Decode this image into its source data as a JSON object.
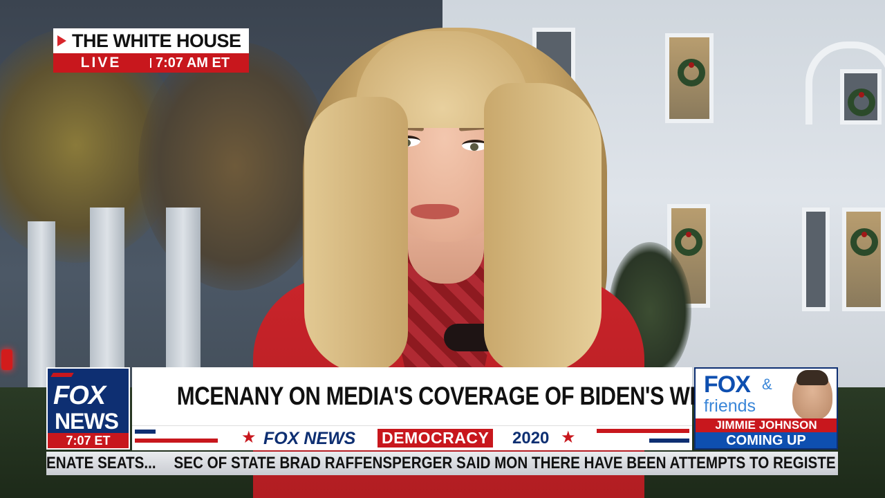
{
  "location_bug": {
    "place": "THE WHITE HOUSE",
    "status": "LIVE",
    "time": "7:07 AM ET"
  },
  "network_logo": {
    "line1": "FOX",
    "line2": "NEWS",
    "time": "7:07 ET"
  },
  "headline": "MCENANY ON MEDIA'S COVERAGE OF BIDEN'S WH PICKS",
  "democracy_banner": {
    "brand": "FOX NEWS",
    "word": "DEMOCRACY",
    "year": "2020"
  },
  "promo": {
    "show_line1": "FOX",
    "show_amp": "&",
    "show_line2": "friends",
    "guest": "JIMMIE JOHNSON",
    "tag": "COMING UP"
  },
  "ticker": {
    "items": [
      "ENATE SEATS...",
      "SEC OF STATE BRAD RAFFENSPERGER SAID MON THERE HAVE BEEN ATTEMPTS TO REGISTE"
    ]
  },
  "colors": {
    "fox_red": "#c8171d",
    "fox_navy": "#0e2f72",
    "friends_blue": "#0e4fb0"
  }
}
